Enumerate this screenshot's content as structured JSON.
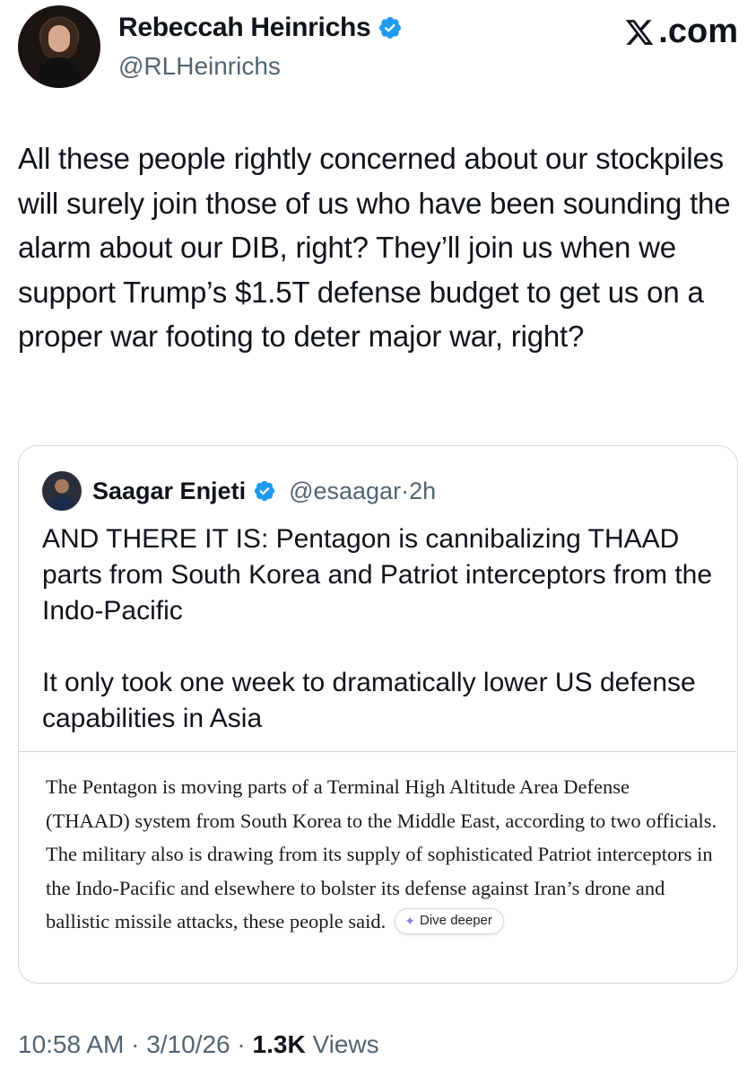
{
  "author": {
    "name": "Rebeccah Heinrichs",
    "handle": "@RLHeinrichs"
  },
  "brand": {
    "label": ".com",
    "icon": "x-logo-icon"
  },
  "tweet": {
    "text": "All these people rightly concerned about our stockpiles will surely join those of us who have been sounding the alarm about our DIB, right? They’ll join us when we support Trump’s $1.5T defense budget to get us on a proper war footing to deter major war, right?"
  },
  "quoted": {
    "name": "Saagar Enjeti",
    "handle": "@esaagar",
    "separator": "·",
    "time": "2h",
    "paragraphs": [
      "AND THERE IT IS: Pentagon is cannibalizing THAAD parts from South Korea and Patriot interceptors from the Indo-Pacific",
      "It only took one week to dramatically lower US defense capabilities in Asia"
    ],
    "article_text": "The Pentagon is moving parts of a Terminal High Altitude Area Defense (THAAD) system from South Korea to the Middle East, according to two officials. The military also is drawing from its supply of sophisticated Patriot interceptors in the Indo-Pacific and elsewhere to bolster its defense against Iran’s drone and ballistic missile attacks, these people said.",
    "dive_label": "Dive deeper"
  },
  "meta": {
    "time": "10:58 AM",
    "sep1": " · ",
    "date": "3/10/26",
    "sep2": " · ",
    "views_count": "1.3K",
    "views_label": " Views"
  },
  "colors": {
    "verified": "#1d9bf0",
    "secondary_text": "#536471",
    "border": "#cfd9de"
  }
}
